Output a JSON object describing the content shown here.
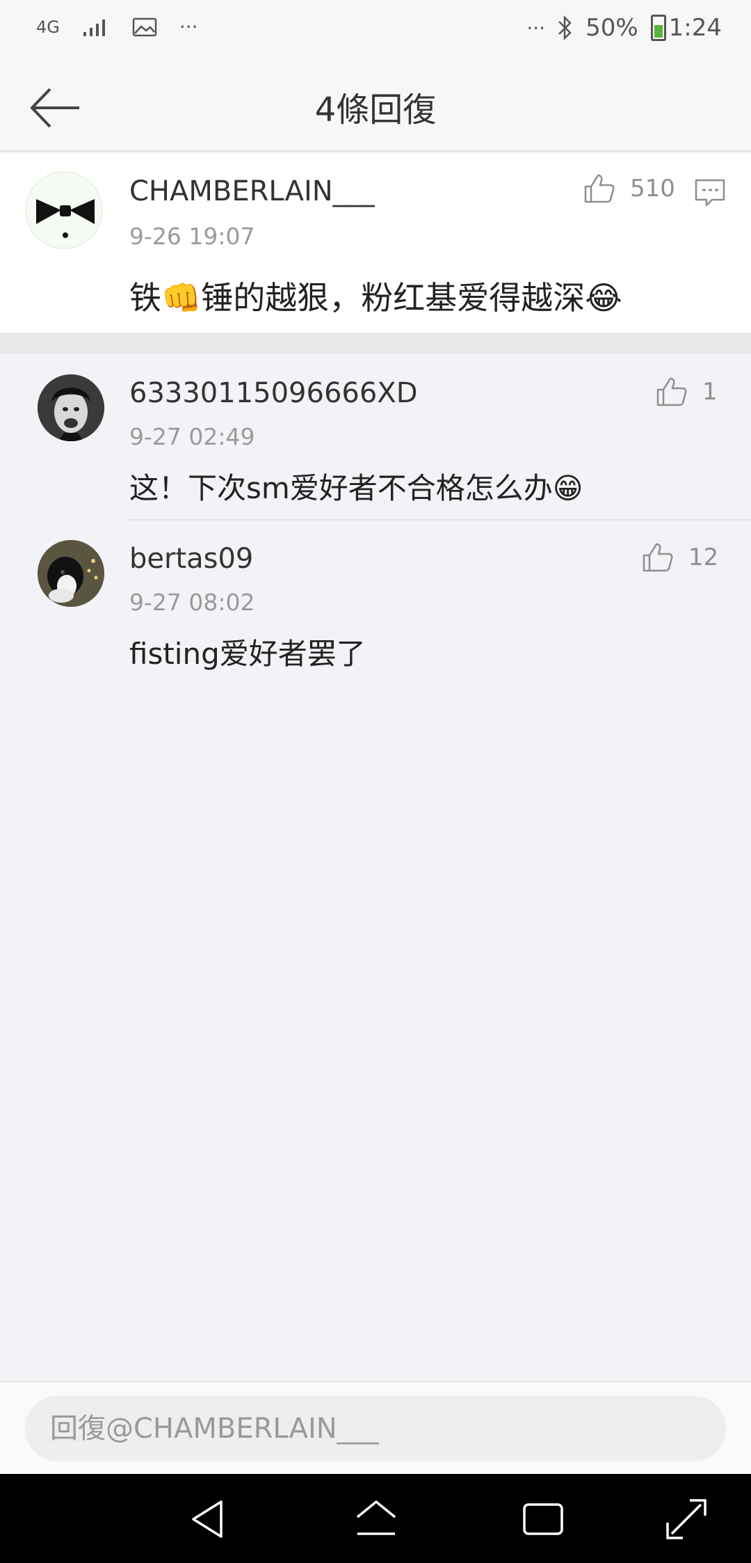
{
  "status_bar": {
    "network": "4G",
    "overflow_left": "···",
    "overflow_right": "···",
    "battery": "50%",
    "time": "1:24"
  },
  "header": {
    "title": "4條回復"
  },
  "main_comment": {
    "username": "CHAMBERLAIN___",
    "time": "9-26 19:07",
    "text": "铁👊锤的越狠，粉红基爱得越深😂",
    "likes": "510"
  },
  "replies": [
    {
      "username": "63330115096666XD",
      "time": "9-27 02:49",
      "text": "这！下次sm爱好者不合格怎么办😁",
      "likes": "1"
    },
    {
      "username": "bertas09",
      "time": "9-27 08:02",
      "text": "fisting爱好者罢了",
      "likes": "12"
    }
  ],
  "input": {
    "placeholder": "回復@CHAMBERLAIN___"
  },
  "colors": {
    "background": "#f4f4f8",
    "text": "#333333",
    "muted": "#9a9a9a",
    "icon": "#8e8e8e"
  },
  "icons": [
    "back-arrow-icon",
    "thumbs-up-icon",
    "comment-icon",
    "nav-back-icon",
    "nav-home-icon",
    "nav-recents-icon",
    "nav-expand-icon"
  ]
}
